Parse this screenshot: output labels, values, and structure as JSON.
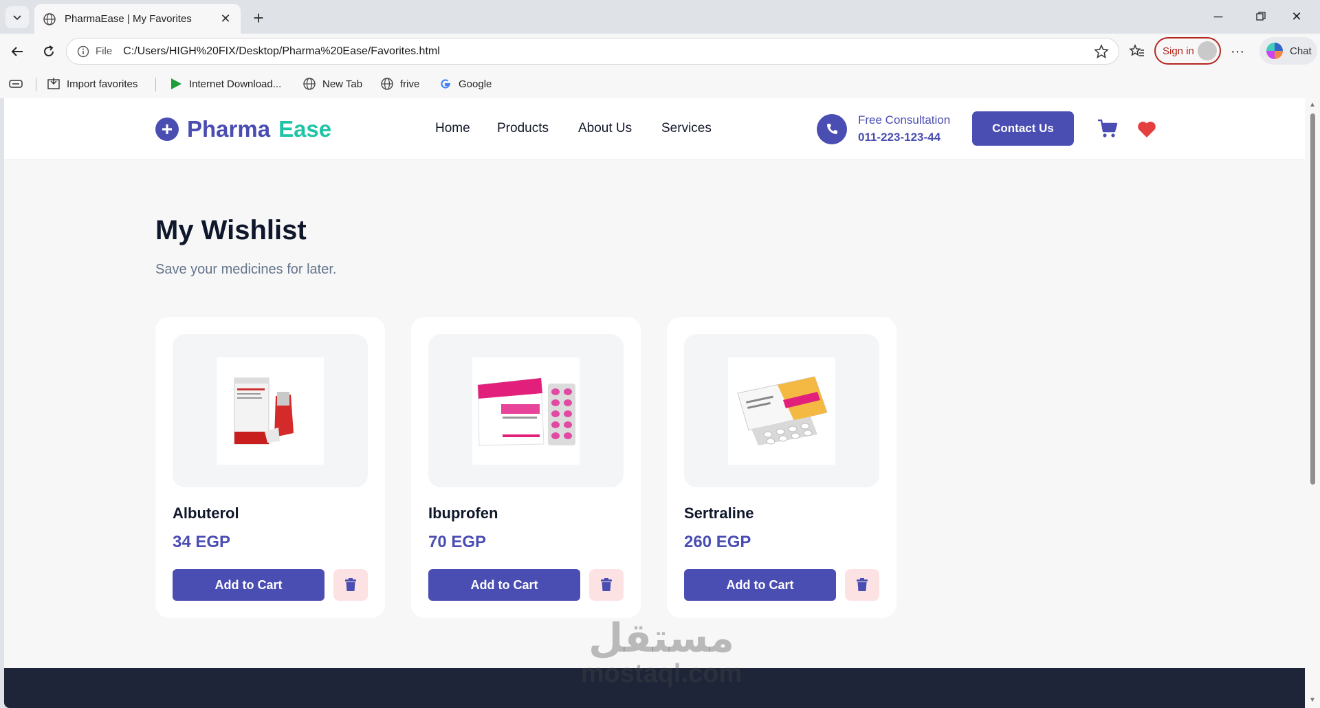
{
  "browser": {
    "tab_title": "PharmaEase | My Favorites",
    "address_prefix": "File",
    "url": "C:/Users/HIGH%20FIX/Desktop/Pharma%20Ease/Favorites.html",
    "signin_label": "Sign in",
    "chat_label": "Chat",
    "favorites": [
      {
        "label": "Import favorites",
        "icon": "import-icon"
      },
      {
        "label": "Internet Download...",
        "icon": "play-icon"
      },
      {
        "label": "New Tab",
        "icon": "globe-icon"
      },
      {
        "label": "frive",
        "icon": "globe-icon"
      },
      {
        "label": "Google",
        "icon": "google-icon"
      }
    ]
  },
  "site": {
    "logo_part1": "Pharma",
    "logo_part2": "Ease",
    "nav": [
      "Home",
      "Products",
      "About Us",
      "Services"
    ],
    "consult_label": "Free Consultation",
    "consult_phone": "011-223-123-44",
    "contact_button": "Contact Us"
  },
  "page": {
    "title": "My Wishlist",
    "subtitle": "Save your medicines for later."
  },
  "wishlist": [
    {
      "name": "Albuterol",
      "price": "34 EGP",
      "add_label": "Add to Cart"
    },
    {
      "name": "Ibuprofen",
      "price": "70 EGP",
      "add_label": "Add to Cart"
    },
    {
      "name": "Sertraline",
      "price": "260 EGP",
      "add_label": "Add to Cart"
    }
  ],
  "watermark": {
    "arabic": "مستقل",
    "latin": "mostaql.com"
  },
  "colors": {
    "brand_primary": "#4a4db1",
    "brand_accent": "#1fc4a6",
    "delete_bg": "#fde2e4",
    "heart": "#e53e3e",
    "footer": "#1e2538"
  }
}
